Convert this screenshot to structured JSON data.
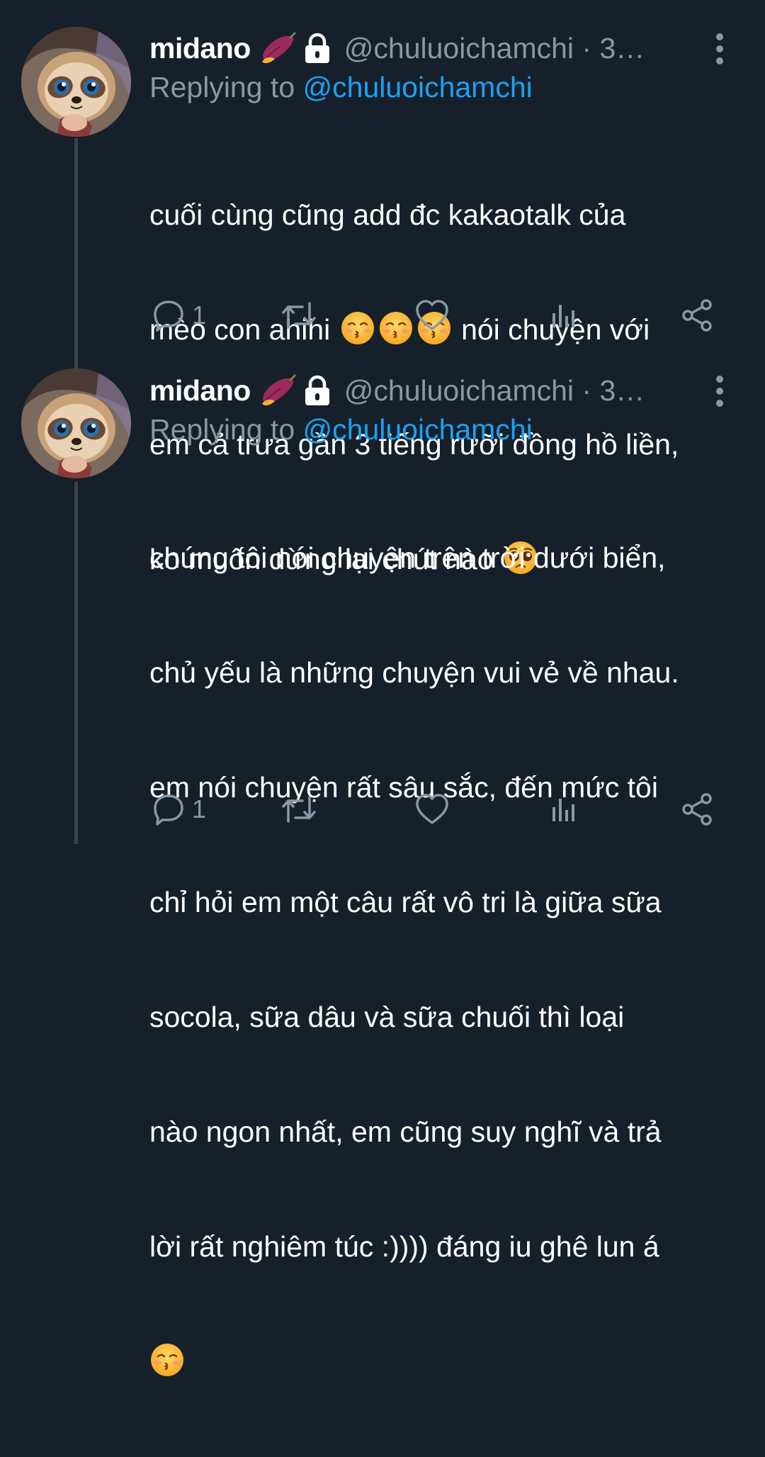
{
  "tweets": [
    {
      "display_name": "midano",
      "name_emoji": "sweet-potato-emoji",
      "handle_time": "@chuluoichamchi · 3…",
      "replying_prefix": "Replying to",
      "replying_handle": "@chuluoichamchi",
      "text_lines": [
        "cuối cùng cũng add đc kakaotalk của",
        "mèo con ahihi",
        " nói chuyện với",
        "em cả trưa gần 3 tiếng rưỡi đồng hồ liền,",
        "ko muốn dừng lại chút nào"
      ],
      "reply_count": "1"
    },
    {
      "display_name": "midano",
      "name_emoji": "sweet-potato-emoji",
      "handle_time": "@chuluoichamchi · 3…",
      "replying_prefix": "Replying to",
      "replying_handle": "@chuluoichamchi",
      "text_lines": [
        "chúng tôi nói chuyện trên trời dưới biển,",
        "chủ yếu là những chuyện vui vẻ về nhau.",
        "em nói chuyện rất sâu sắc, đến mức tôi",
        "chỉ hỏi em một câu rất vô tri là giữa sữa",
        "socola, sữa dâu và sữa chuối thì loại",
        "nào ngon nhất, em cũng suy nghĩ và trả",
        "lời rất nghiêm túc :)))) đáng iu ghê lun á"
      ],
      "reply_count": "1"
    }
  ],
  "colors": {
    "background": "#15202b",
    "secondary_text": "#8899a6",
    "link": "#1da1f2",
    "thread_line": "#38444d"
  },
  "icons": [
    "lock-icon",
    "more-icon",
    "reply-icon",
    "retweet-icon",
    "like-icon",
    "analytics-icon",
    "share-icon",
    "kissing-face-emoji",
    "pleading-face-emoji"
  ]
}
